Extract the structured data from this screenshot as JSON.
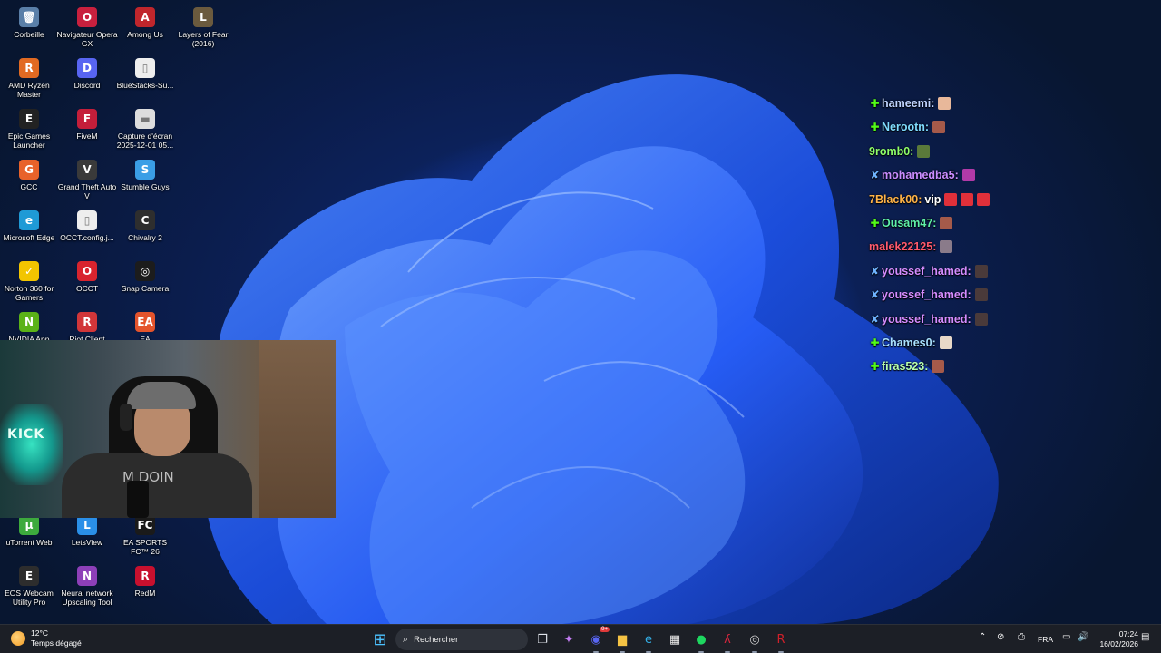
{
  "desktop": {
    "icons": [
      {
        "label": "Corbeille",
        "icon": "recycle-bin-icon",
        "color": "#5a7fa8",
        "glyph": "🗑"
      },
      {
        "label": "Navigateur Opera GX",
        "icon": "opera-gx-icon",
        "color": "#c8203e",
        "glyph": "O"
      },
      {
        "label": "Among Us",
        "icon": "among-us-icon",
        "color": "#c0262c",
        "glyph": "A"
      },
      {
        "label": "Layers of Fear (2016)",
        "icon": "layers-of-fear-icon",
        "color": "#6b5a3e",
        "glyph": "L"
      },
      {
        "label": "AMD Ryzen Master",
        "icon": "amd-ryzen-icon",
        "color": "#e16a22",
        "glyph": "R"
      },
      {
        "label": "Discord",
        "icon": "discord-icon",
        "color": "#5865f2",
        "glyph": "D"
      },
      {
        "label": "BlueStacks-Su...",
        "icon": "file-icon",
        "color": "#eeeeee",
        "glyph": "▯"
      },
      {
        "label": "Epic Games Launcher",
        "icon": "epic-games-icon",
        "color": "#222222",
        "glyph": "E"
      },
      {
        "label": "FiveM",
        "icon": "fivem-icon",
        "color": "#c41e3a",
        "glyph": "F"
      },
      {
        "label": "Capture d'écran 2025-12-01 05...",
        "icon": "screenshot-file-icon",
        "color": "#dddddd",
        "glyph": "▬"
      },
      {
        "label": "GCC",
        "icon": "gcc-icon",
        "color": "#e8622a",
        "glyph": "G"
      },
      {
        "label": "Grand Theft Auto V",
        "icon": "gta-v-icon",
        "color": "#3a3a3a",
        "glyph": "V"
      },
      {
        "label": "Stumble Guys",
        "icon": "stumble-guys-icon",
        "color": "#3a9ee6",
        "glyph": "S"
      },
      {
        "label": "Microsoft Edge",
        "icon": "edge-icon",
        "color": "#1f9ad6",
        "glyph": "e"
      },
      {
        "label": "OCCT.config.j...",
        "icon": "file-icon",
        "color": "#eeeeee",
        "glyph": "▯"
      },
      {
        "label": "Chivalry 2",
        "icon": "chivalry-icon",
        "color": "#2e2e2e",
        "glyph": "C"
      },
      {
        "label": "Norton 360 for Gamers",
        "icon": "norton-icon",
        "color": "#f2c500",
        "glyph": "✓"
      },
      {
        "label": "OCCT",
        "icon": "occt-icon",
        "color": "#d8242e",
        "glyph": "O"
      },
      {
        "label": "Snap Camera",
        "icon": "snap-camera-icon",
        "color": "#1c1c1c",
        "glyph": "◎"
      },
      {
        "label": "NVIDIA App",
        "icon": "nvidia-icon",
        "color": "#5bb217",
        "glyph": "N"
      },
      {
        "label": "Riot Client",
        "icon": "riot-icon",
        "color": "#d13639",
        "glyph": "R"
      },
      {
        "label": "EA",
        "icon": "ea-icon",
        "color": "#e4542c",
        "glyph": "EA"
      },
      {
        "label": "uTorrent Web",
        "icon": "utorrent-icon",
        "color": "#3daa3d",
        "glyph": "µ"
      },
      {
        "label": "LetsView",
        "icon": "letsview-icon",
        "color": "#2a8fe8",
        "glyph": "L"
      },
      {
        "label": "EA SPORTS FC™ 26",
        "icon": "ea-fc-icon",
        "color": "#1a1a1a",
        "glyph": "FC"
      },
      {
        "label": "EOS Webcam Utility Pro",
        "icon": "eos-webcam-icon",
        "color": "#2d2d2d",
        "glyph": "E"
      },
      {
        "label": "Neural network Upscaling Tool",
        "icon": "upscaling-icon",
        "color": "#8d3fb8",
        "glyph": "N"
      },
      {
        "label": "RedM",
        "icon": "redm-icon",
        "color": "#c8102e",
        "glyph": "R"
      }
    ]
  },
  "chat": {
    "messages": [
      {
        "badge": "✚",
        "badge_color": "#53fc18",
        "user": "hameemi:",
        "user_color": "#c0d4ff",
        "message": "",
        "emotes": [
          "#e8b89a"
        ]
      },
      {
        "badge": "✚",
        "badge_color": "#53fc18",
        "user": "Nerootn:",
        "user_color": "#7fdcff",
        "message": "",
        "emotes": [
          "#a55a4a"
        ]
      },
      {
        "badge": "",
        "badge_color": "",
        "user": "9romb0:",
        "user_color": "#8fff6a",
        "message": "",
        "emotes": [
          "#5a7a3a"
        ]
      },
      {
        "badge": "✘",
        "badge_color": "#6fb4ff",
        "user": "mohamedba5:",
        "user_color": "#c98cff",
        "message": "",
        "emotes": [
          "#b23aa8"
        ]
      },
      {
        "badge": "",
        "badge_color": "",
        "user": "7Black00:",
        "user_color": "#ffb347",
        "message": "vip",
        "emotes": [
          "#e0303a",
          "#e0303a",
          "#e0303a"
        ]
      },
      {
        "badge": "✚",
        "badge_color": "#53fc18",
        "user": "Ousam47:",
        "user_color": "#5ff0a8",
        "message": "",
        "emotes": [
          "#a55a4a"
        ]
      },
      {
        "badge": "",
        "badge_color": "",
        "user": "malek22125:",
        "user_color": "#ff5a6e",
        "message": "",
        "emotes": [
          "#8a7b8a"
        ]
      },
      {
        "badge": "✘",
        "badge_color": "#6fb4ff",
        "user": "youssef_hamed:",
        "user_color": "#d48cff",
        "message": "",
        "emotes": [
          "#4a3a3a"
        ]
      },
      {
        "badge": "✘",
        "badge_color": "#6fb4ff",
        "user": "youssef_hamed:",
        "user_color": "#d48cff",
        "message": "",
        "emotes": [
          "#4a3a3a"
        ]
      },
      {
        "badge": "✘",
        "badge_color": "#6fb4ff",
        "user": "youssef_hamed:",
        "user_color": "#d48cff",
        "message": "",
        "emotes": [
          "#4a3a3a"
        ]
      },
      {
        "badge": "✚",
        "badge_color": "#53fc18",
        "user": "Chames0:",
        "user_color": "#a8e0ff",
        "message": "",
        "emotes": [
          "#e8d8c8"
        ]
      },
      {
        "badge": "✚",
        "badge_color": "#53fc18",
        "user": "firas523:",
        "user_color": "#b8ffb0",
        "message": "",
        "emotes": [
          "#a55a4a"
        ]
      }
    ]
  },
  "webcam": {
    "neon_text": "KICK",
    "shirt_text": "M DOIN"
  },
  "taskbar": {
    "weather": {
      "temperature": "12°C",
      "condition": "Temps dégagé"
    },
    "search_placeholder": "Rechercher",
    "apps": [
      {
        "name": "start-button",
        "glyph": "⊞",
        "color": "#4cc2ff"
      },
      {
        "name": "search-box",
        "glyph": "",
        "color": ""
      },
      {
        "name": "task-view-icon",
        "glyph": "❐",
        "color": "#dfe3ea"
      },
      {
        "name": "copilot-icon",
        "glyph": "✦",
        "color": "#c27cf2"
      },
      {
        "name": "discord-taskbar-icon",
        "glyph": "◉",
        "color": "#5865f2",
        "badge": "9+"
      },
      {
        "name": "file-explorer-icon",
        "glyph": "▆",
        "color": "#f5c344"
      },
      {
        "name": "edge-taskbar-icon",
        "glyph": "e",
        "color": "#33b0e8"
      },
      {
        "name": "store-icon",
        "glyph": "▦",
        "color": "#e8e8e8"
      },
      {
        "name": "spotify-icon",
        "glyph": "●",
        "color": "#1ed760"
      },
      {
        "name": "fivem-taskbar-icon",
        "glyph": "ʎ",
        "color": "#d7263d"
      },
      {
        "name": "obs-icon",
        "glyph": "◎",
        "color": "#d0d0d0"
      },
      {
        "name": "redm-taskbar-icon",
        "glyph": "R",
        "color": "#d0202a"
      }
    ],
    "tray": {
      "language": "FRA",
      "time": "07:24",
      "date": "16/02/2026"
    }
  }
}
